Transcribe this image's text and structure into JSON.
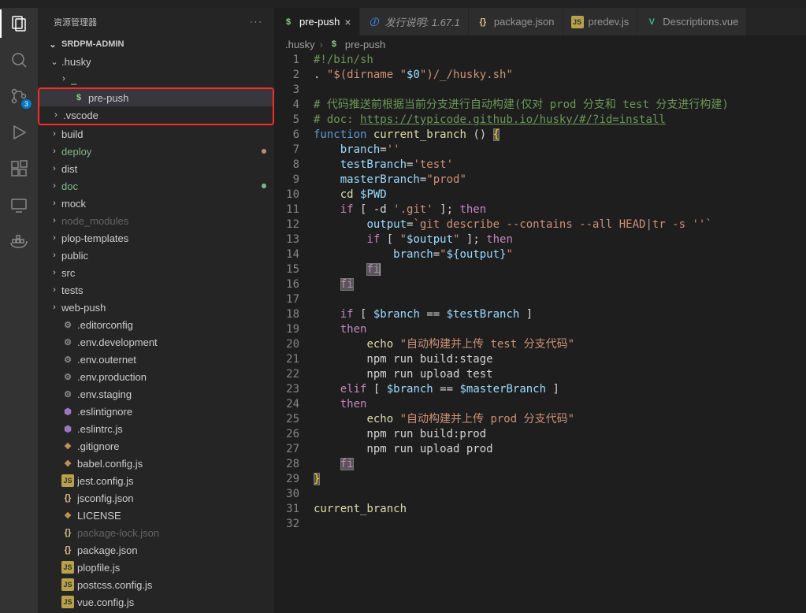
{
  "sidebar": {
    "title": "资源管理器",
    "root": "SRDPM-ADMIN",
    "badge_scm": "3",
    "items": [
      {
        "name": ".husky",
        "kind": "folder",
        "open": true,
        "color": "",
        "indent": 0
      },
      {
        "name": "_",
        "kind": "folder",
        "open": false,
        "color": "",
        "indent": 1
      },
      {
        "name": "pre-push",
        "kind": "sh",
        "open": null,
        "color": "",
        "indent": 1,
        "selected": true,
        "boxed": true
      },
      {
        "name": ".vscode",
        "kind": "folder",
        "open": false,
        "color": "",
        "indent": 0,
        "boxed": true
      },
      {
        "name": "build",
        "kind": "folder",
        "open": false,
        "color": "",
        "indent": 0
      },
      {
        "name": "deploy",
        "kind": "folder",
        "open": false,
        "color": "green",
        "indent": 0,
        "dot": "u"
      },
      {
        "name": "dist",
        "kind": "folder",
        "open": false,
        "color": "",
        "indent": 0
      },
      {
        "name": "doc",
        "kind": "folder",
        "open": false,
        "color": "green",
        "indent": 0,
        "dot": "a"
      },
      {
        "name": "mock",
        "kind": "folder",
        "open": false,
        "color": "",
        "indent": 0
      },
      {
        "name": "node_modules",
        "kind": "folder",
        "open": false,
        "color": "gray",
        "indent": 0
      },
      {
        "name": "plop-templates",
        "kind": "folder",
        "open": false,
        "color": "",
        "indent": 0
      },
      {
        "name": "public",
        "kind": "folder",
        "open": false,
        "color": "",
        "indent": 0
      },
      {
        "name": "src",
        "kind": "folder",
        "open": false,
        "color": "",
        "indent": 0
      },
      {
        "name": "tests",
        "kind": "folder",
        "open": false,
        "color": "",
        "indent": 0
      },
      {
        "name": "web-push",
        "kind": "folder",
        "open": false,
        "color": "",
        "indent": 0
      },
      {
        "name": ".editorconfig",
        "kind": "gear",
        "indent": 0
      },
      {
        "name": ".env.development",
        "kind": "gear",
        "indent": 0
      },
      {
        "name": ".env.outernet",
        "kind": "gear",
        "indent": 0
      },
      {
        "name": ".env.production",
        "kind": "gear",
        "indent": 0
      },
      {
        "name": ".env.staging",
        "kind": "gear",
        "indent": 0
      },
      {
        "name": ".eslintignore",
        "kind": "hex",
        "indent": 0
      },
      {
        "name": ".eslintrc.js",
        "kind": "hex",
        "indent": 0
      },
      {
        "name": ".gitignore",
        "kind": "brown",
        "indent": 0
      },
      {
        "name": "babel.config.js",
        "kind": "brown",
        "indent": 0
      },
      {
        "name": "jest.config.js",
        "kind": "js",
        "indent": 0
      },
      {
        "name": "jsconfig.json",
        "kind": "json",
        "indent": 0
      },
      {
        "name": "LICENSE",
        "kind": "brown",
        "indent": 0
      },
      {
        "name": "package-lock.json",
        "kind": "json",
        "indent": 0,
        "color": "gray"
      },
      {
        "name": "package.json",
        "kind": "json",
        "indent": 0
      },
      {
        "name": "plopfile.js",
        "kind": "js",
        "indent": 0
      },
      {
        "name": "postcss.config.js",
        "kind": "js",
        "indent": 0
      },
      {
        "name": "vue.config.js",
        "kind": "js",
        "indent": 0
      }
    ]
  },
  "tabs": [
    {
      "icon": "sh",
      "label": "pre-push",
      "active": true
    },
    {
      "icon": "info",
      "label": "发行说明: 1.67.1",
      "active": false,
      "italic": true
    },
    {
      "icon": "json",
      "label": "package.json",
      "active": false
    },
    {
      "icon": "js",
      "label": "predev.js",
      "active": false
    },
    {
      "icon": "vue",
      "label": "Descriptions.vue",
      "active": false
    }
  ],
  "breadcrumb": [
    ".husky",
    "pre-push"
  ],
  "code": {
    "lines": [
      {
        "n": 1,
        "seg": [
          [
            "c-comment",
            "#!/bin/sh"
          ]
        ]
      },
      {
        "n": 2,
        "seg": [
          [
            "c-fn",
            "."
          ],
          [
            "c-op",
            " "
          ],
          [
            "c-string",
            "\"$(dirname \""
          ],
          [
            "c-var",
            "$0"
          ],
          [
            "c-string",
            "\")/_/husky.sh\""
          ]
        ]
      },
      {
        "n": 3,
        "seg": []
      },
      {
        "n": 4,
        "seg": [
          [
            "c-comment",
            "# 代码推送前根据当前分支进行自动构建(仅对 prod 分支和 test 分支进行构建)"
          ]
        ]
      },
      {
        "n": 5,
        "seg": [
          [
            "c-comment",
            "# doc: "
          ],
          [
            "c-link",
            "https://typicode.github.io/husky/#/?id=install"
          ]
        ]
      },
      {
        "n": 6,
        "seg": [
          [
            "c-kw",
            "function"
          ],
          [
            "c-op",
            " "
          ],
          [
            "c-fn",
            "current_branch"
          ],
          [
            "c-op",
            " () "
          ],
          [
            "c-brace hl",
            "{"
          ]
        ]
      },
      {
        "n": 7,
        "seg": [
          [
            "c-op",
            "    "
          ],
          [
            "c-var",
            "branch"
          ],
          [
            "c-op",
            "="
          ],
          [
            "c-string",
            "''"
          ]
        ]
      },
      {
        "n": 8,
        "seg": [
          [
            "c-op",
            "    "
          ],
          [
            "c-var",
            "testBranch"
          ],
          [
            "c-op",
            "="
          ],
          [
            "c-string",
            "'test'"
          ]
        ]
      },
      {
        "n": 9,
        "seg": [
          [
            "c-op",
            "    "
          ],
          [
            "c-var",
            "masterBranch"
          ],
          [
            "c-op",
            "="
          ],
          [
            "c-string",
            "\"prod\""
          ]
        ]
      },
      {
        "n": 10,
        "seg": [
          [
            "c-op",
            "    "
          ],
          [
            "c-fn",
            "cd"
          ],
          [
            "c-op",
            " "
          ],
          [
            "c-var",
            "$PWD"
          ]
        ]
      },
      {
        "n": 11,
        "seg": [
          [
            "c-op",
            "    "
          ],
          [
            "c-pink",
            "if"
          ],
          [
            "c-op",
            " [ -d "
          ],
          [
            "c-string",
            "'.git'"
          ],
          [
            "c-op",
            " ]; "
          ],
          [
            "c-pink",
            "then"
          ]
        ]
      },
      {
        "n": 12,
        "seg": [
          [
            "c-op",
            "        "
          ],
          [
            "c-var",
            "output"
          ],
          [
            "c-op",
            "="
          ],
          [
            "c-string",
            "`git describe --contains --all HEAD|tr -s ''`"
          ]
        ]
      },
      {
        "n": 13,
        "seg": [
          [
            "c-op",
            "        "
          ],
          [
            "c-pink",
            "if"
          ],
          [
            "c-op",
            " [ "
          ],
          [
            "c-string",
            "\""
          ],
          [
            "c-var",
            "$output"
          ],
          [
            "c-string",
            "\""
          ],
          [
            "c-op",
            " ]; "
          ],
          [
            "c-pink",
            "then"
          ]
        ]
      },
      {
        "n": 14,
        "seg": [
          [
            "c-op",
            "            "
          ],
          [
            "c-var",
            "branch"
          ],
          [
            "c-op",
            "="
          ],
          [
            "c-string",
            "\""
          ],
          [
            "c-var",
            "${output}"
          ],
          [
            "c-string",
            "\""
          ]
        ]
      },
      {
        "n": 15,
        "seg": [
          [
            "c-op",
            "        "
          ],
          [
            "c-pink hl",
            "fi"
          ],
          [
            "cursor",
            ""
          ]
        ]
      },
      {
        "n": 16,
        "seg": [
          [
            "c-op",
            "    "
          ],
          [
            "c-pink hl",
            "fi"
          ]
        ]
      },
      {
        "n": 17,
        "seg": []
      },
      {
        "n": 18,
        "seg": [
          [
            "c-op",
            "    "
          ],
          [
            "c-pink",
            "if"
          ],
          [
            "c-op",
            " [ "
          ],
          [
            "c-var",
            "$branch"
          ],
          [
            "c-op",
            " == "
          ],
          [
            "c-var",
            "$testBranch"
          ],
          [
            "c-op",
            " ]"
          ]
        ]
      },
      {
        "n": 19,
        "seg": [
          [
            "c-op",
            "    "
          ],
          [
            "c-pink",
            "then"
          ]
        ]
      },
      {
        "n": 20,
        "seg": [
          [
            "c-op",
            "        "
          ],
          [
            "c-fn",
            "echo"
          ],
          [
            "c-op",
            " "
          ],
          [
            "c-string",
            "\"自动构建并上传 test 分支代码\""
          ]
        ]
      },
      {
        "n": 21,
        "seg": [
          [
            "c-op",
            "        npm run build:stage"
          ]
        ]
      },
      {
        "n": 22,
        "seg": [
          [
            "c-op",
            "        npm run upload test"
          ]
        ]
      },
      {
        "n": 23,
        "seg": [
          [
            "c-op",
            "    "
          ],
          [
            "c-pink",
            "elif"
          ],
          [
            "c-op",
            " [ "
          ],
          [
            "c-var",
            "$branch"
          ],
          [
            "c-op",
            " == "
          ],
          [
            "c-var",
            "$masterBranch"
          ],
          [
            "c-op",
            " ]"
          ]
        ]
      },
      {
        "n": 24,
        "seg": [
          [
            "c-op",
            "    "
          ],
          [
            "c-pink",
            "then"
          ]
        ]
      },
      {
        "n": 25,
        "seg": [
          [
            "c-op",
            "        "
          ],
          [
            "c-fn",
            "echo"
          ],
          [
            "c-op",
            " "
          ],
          [
            "c-string",
            "\"自动构建并上传 prod 分支代码\""
          ]
        ]
      },
      {
        "n": 26,
        "seg": [
          [
            "c-op",
            "        npm run build:prod"
          ]
        ]
      },
      {
        "n": 27,
        "seg": [
          [
            "c-op",
            "        npm run upload prod"
          ]
        ]
      },
      {
        "n": 28,
        "seg": [
          [
            "c-op",
            "    "
          ],
          [
            "c-pink hl",
            "fi"
          ]
        ]
      },
      {
        "n": 29,
        "seg": [
          [
            "c-brace hl",
            "}"
          ]
        ]
      },
      {
        "n": 30,
        "seg": []
      },
      {
        "n": 31,
        "seg": [
          [
            "c-fn",
            "current_branch"
          ]
        ]
      },
      {
        "n": 32,
        "seg": []
      }
    ]
  }
}
